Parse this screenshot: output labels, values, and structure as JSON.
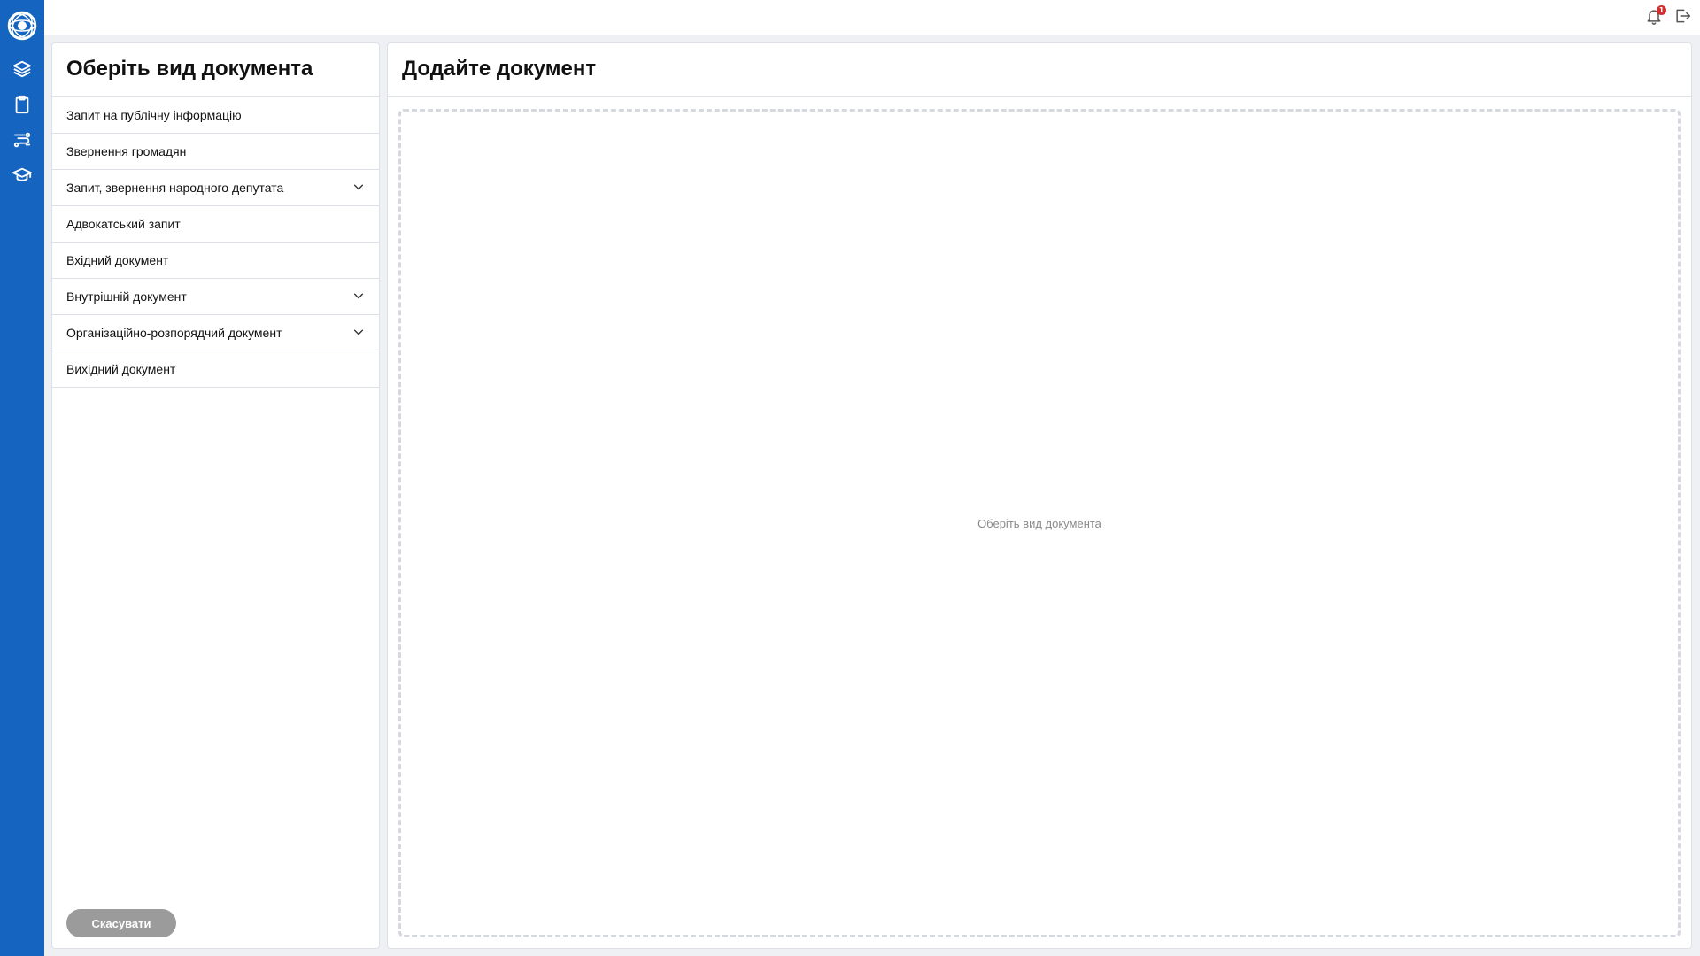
{
  "sidebar": {
    "logo_icon": "globe-logo-icon",
    "nav": [
      {
        "name": "layers-icon"
      },
      {
        "name": "clipboard-icon"
      },
      {
        "name": "routes-icon"
      },
      {
        "name": "graduation-cap-icon"
      }
    ],
    "color": "#1565c0"
  },
  "topbar": {
    "notifications_icon": "bell-icon",
    "notifications_count": "1",
    "logout_icon": "logout-icon"
  },
  "left_panel": {
    "title": "Оберіть вид документа",
    "items": [
      {
        "label": "Запит на публічну інформацію",
        "expandable": false
      },
      {
        "label": "Звернення громадян",
        "expandable": false
      },
      {
        "label": "Запит, звернення народного депутата",
        "expandable": true
      },
      {
        "label": "Адвокатський запит",
        "expandable": false
      },
      {
        "label": "Вхідний документ",
        "expandable": false
      },
      {
        "label": "Внутрішній документ",
        "expandable": true
      },
      {
        "label": "Організаційно-розпорядчий документ",
        "expandable": true
      },
      {
        "label": "Вихідний документ",
        "expandable": false
      }
    ],
    "cancel_label": "Скасувати"
  },
  "right_panel": {
    "title": "Додайте документ",
    "drop_hint": "Оберіть вид документа"
  }
}
